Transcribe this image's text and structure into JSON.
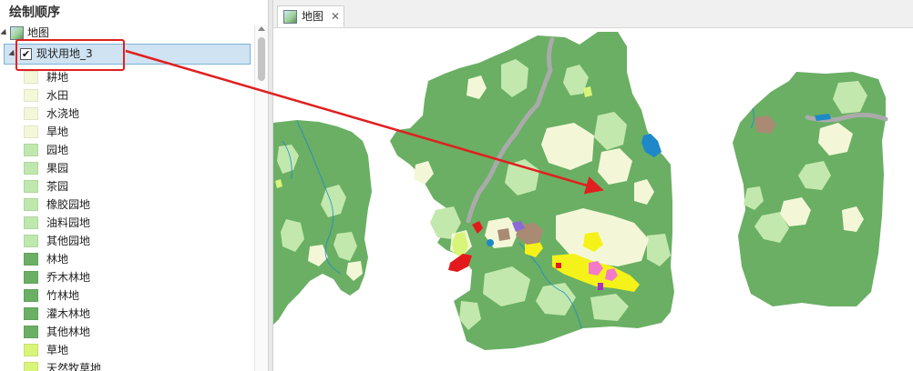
{
  "contents_pane": {
    "title": "绘制顺序",
    "map_node": {
      "label": "地图"
    },
    "layer_node": {
      "label": "现状用地_3",
      "checked": true,
      "check_glyph": "✔"
    },
    "legend": [
      {
        "label": "耕地",
        "color": "#f5f8d8"
      },
      {
        "label": "水田",
        "color": "#f5f8d8"
      },
      {
        "label": "水浇地",
        "color": "#f5f8d8"
      },
      {
        "label": "旱地",
        "color": "#f5f8d8"
      },
      {
        "label": "园地",
        "color": "#bfe8ae"
      },
      {
        "label": "果园",
        "color": "#bfe8ae"
      },
      {
        "label": "茶园",
        "color": "#bfe8ae"
      },
      {
        "label": "橡胶园地",
        "color": "#bfe8ae"
      },
      {
        "label": "油料园地",
        "color": "#bfe8ae"
      },
      {
        "label": "其他园地",
        "color": "#bfe8ae"
      },
      {
        "label": "林地",
        "color": "#6aaf64"
      },
      {
        "label": "乔木林地",
        "color": "#6aaf64"
      },
      {
        "label": "竹林地",
        "color": "#6aaf64"
      },
      {
        "label": "灌木林地",
        "color": "#6aaf64"
      },
      {
        "label": "其他林地",
        "color": "#6aaf64"
      },
      {
        "label": "草地",
        "color": "#d8f57a"
      },
      {
        "label": "天然牧草地",
        "color": "#d8f57a"
      }
    ]
  },
  "map_view": {
    "tab_label": "地图",
    "close_glyph": "✕",
    "colors": {
      "forest": "#6aaf64",
      "orchard": "#c3e8ad",
      "farmland": "#f3f7d7",
      "grass": "#d8f57a",
      "water": "#1e88c8",
      "urban_yellow": "#f5f219",
      "urban_pink": "#f27ac8",
      "industrial": "#a98a72",
      "road_gray": "#aaaaaa",
      "highlight_red": "#e31a1c"
    }
  },
  "annotation": {
    "color": "#e02020"
  }
}
